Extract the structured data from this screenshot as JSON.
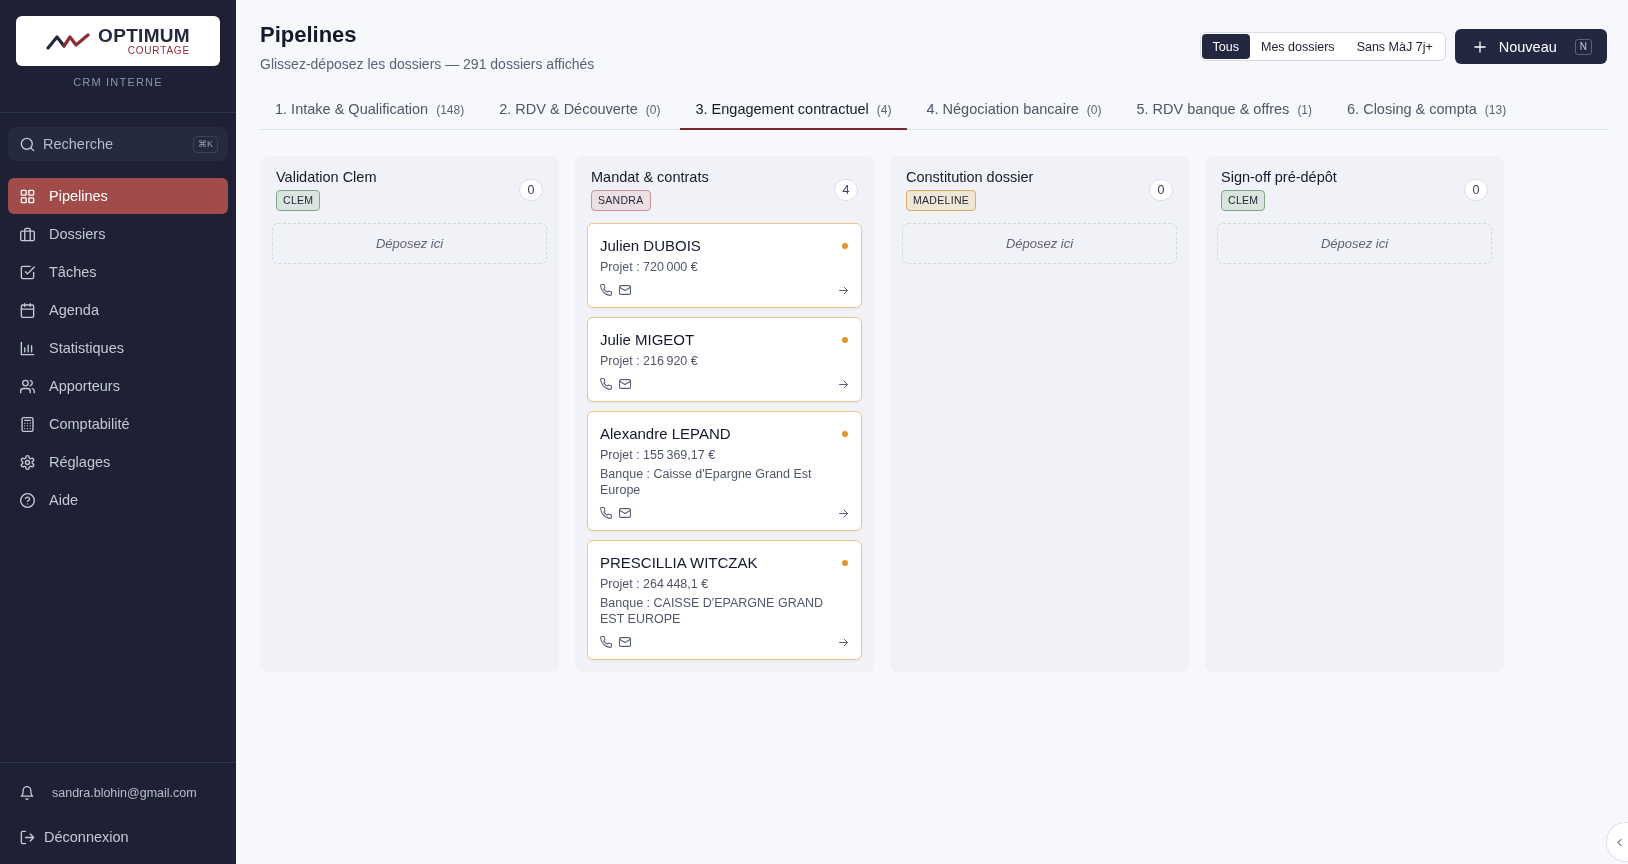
{
  "sidebar": {
    "logo": {
      "name": "OPTIMUM",
      "tagline": "COURTAGE"
    },
    "caption": "CRM INTERNE",
    "search": {
      "placeholder": "Recherche",
      "shortcut": "⌘K"
    },
    "items": [
      {
        "label": "Pipelines",
        "selected": true
      },
      {
        "label": "Dossiers",
        "selected": false
      },
      {
        "label": "Tâches",
        "selected": false
      },
      {
        "label": "Agenda",
        "selected": false
      },
      {
        "label": "Statistiques",
        "selected": false
      },
      {
        "label": "Apporteurs",
        "selected": false
      },
      {
        "label": "Comptabilité",
        "selected": false
      },
      {
        "label": "Réglages",
        "selected": false
      },
      {
        "label": "Aide",
        "selected": false
      }
    ],
    "user_email": "sandra.blohin@gmail.com",
    "logout": "Déconnexion"
  },
  "header": {
    "title": "Pipelines",
    "subtitle": "Glissez-déposez les dossiers — 291 dossiers affichés",
    "filters": [
      {
        "label": "Tous",
        "selected": true
      },
      {
        "label": "Mes dossiers",
        "selected": false
      },
      {
        "label": "Sans MàJ 7j+",
        "selected": false
      }
    ],
    "new_button": {
      "label": "Nouveau",
      "shortcut": "N"
    }
  },
  "tabs": [
    {
      "label": "1. Intake & Qualification",
      "count": "(148)",
      "selected": false
    },
    {
      "label": "2. RDV & Découverte",
      "count": "(0)",
      "selected": false
    },
    {
      "label": "3. Engagement contractuel",
      "count": "(4)",
      "selected": true
    },
    {
      "label": "4. Négociation bancaire",
      "count": "(0)",
      "selected": false
    },
    {
      "label": "5. RDV banque & offres",
      "count": "(1)",
      "selected": false
    },
    {
      "label": "6. Closing & compta",
      "count": "(13)",
      "selected": false
    }
  ],
  "columns": [
    {
      "title": "Validation Clem",
      "tag": {
        "label": "CLEM",
        "color": "#7fa88b"
      },
      "count": "0",
      "drop_hint": "Déposez ici"
    },
    {
      "title": "Mandat & contrats",
      "tag": {
        "label": "SANDRA",
        "color": "#c8939c"
      },
      "count": "4",
      "cards": [
        {
          "name": "Julien DUBOIS",
          "project": "Projet : 720 000 €",
          "color": "#e0952a"
        },
        {
          "name": "Julie MIGEOT",
          "project": "Projet : 216 920 €",
          "color": "#e0952a"
        },
        {
          "name": "Alexandre LEPAND",
          "project": "Projet : 155 369,17 €",
          "bank": "Banque : Caisse d'Epargne Grand Est Europe",
          "color": "#e0952a"
        },
        {
          "name": "PRESCILLIA WITCZAK",
          "project": "Projet : 264 448,1 €",
          "bank": "Banque : CAISSE D'EPARGNE GRAND EST EUROPE",
          "color": "#e0952a"
        }
      ]
    },
    {
      "title": "Constitution dossier",
      "tag": {
        "label": "MADELINE",
        "color": "#d9ad62"
      },
      "count": "0",
      "drop_hint": "Déposez ici"
    },
    {
      "title": "Sign-off pré-dépôt",
      "tag": {
        "label": "CLEM",
        "color": "#7fa88b"
      },
      "count": "0",
      "drop_hint": "Déposez ici"
    }
  ]
}
